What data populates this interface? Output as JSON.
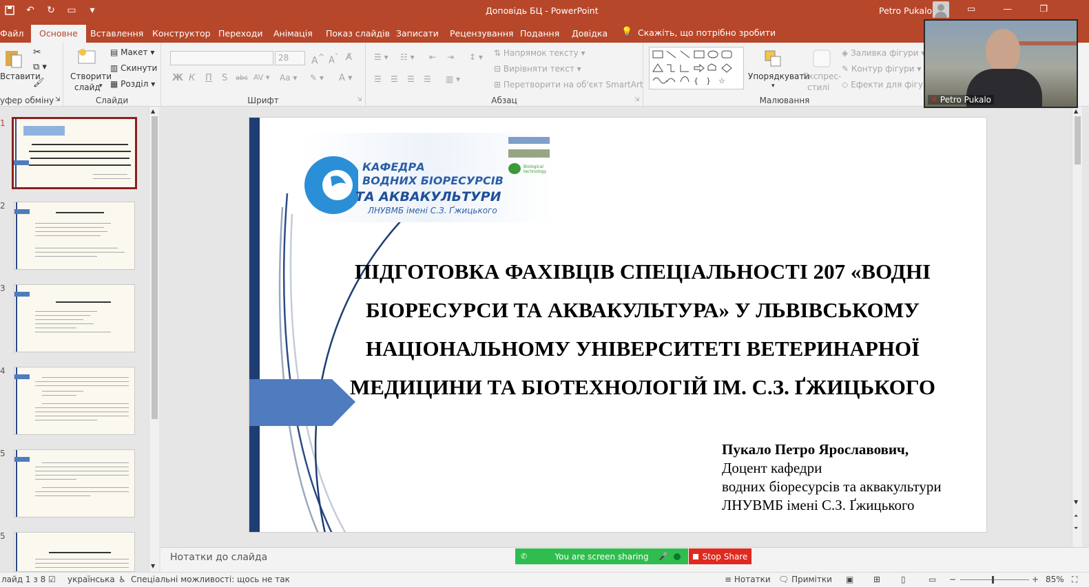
{
  "window": {
    "title": "Доповідь БЦ  -  PowerPoint",
    "user": "Petro Pukalo"
  },
  "tabs": [
    "Файл",
    "Основне",
    "Вставлення",
    "Конструктор",
    "Переходи",
    "Анімація",
    "Показ слайдів",
    "Записати",
    "Рецензування",
    "Подання",
    "Довідка"
  ],
  "tell_me": "Скажіть, що потрібно зробити",
  "ribbon": {
    "clipboard": {
      "paste": "Вставити",
      "label": "уфер обміну"
    },
    "slides": {
      "new_slide_1": "Створити",
      "new_slide_2": "слайд",
      "layout": "Макет",
      "reset": "Скинути",
      "section": "Розділ",
      "label": "Слайди"
    },
    "font": {
      "size": "28",
      "label": "Шрифт",
      "aa": "Aa"
    },
    "paragraph": {
      "text_direction": "Напрямок тексту",
      "align_text": "Вирівняти текст",
      "smartart": "Перетворити на об'єкт SmartArt",
      "label": "Абзац"
    },
    "drawing": {
      "arrange": "Упорядкувати",
      "quick_styles_1": "Експрес-",
      "quick_styles_2": "стилі",
      "shape_fill": "Заливка фігури",
      "shape_outline": "Контур фігури",
      "shape_effects": "Ефекти для фігур",
      "label": "Малювання"
    }
  },
  "thumbnails": [
    {
      "num": "1"
    },
    {
      "num": "2"
    },
    {
      "num": "3"
    },
    {
      "num": "4"
    },
    {
      "num": "5"
    },
    {
      "num": "5"
    }
  ],
  "slide": {
    "logo": {
      "line1": "КАФЕДРА",
      "line2": "ВОДНИХ БІОРЕСУРСІВ",
      "line3": "ТА АКВАКУЛЬТУРИ",
      "line4": "ЛНУВМБ імені С.З. Ґжицького",
      "small": "Biological technology"
    },
    "title": "ПІДГОТОВКА ФАХІВЦІВ СПЕЦІАЛЬНОСТІ 207 «ВОДНІ БІОРЕСУРСИ ТА АКВАКУЛЬТУРА» У ЛЬВІВСЬКОМУ НАЦІОНАЛЬНОМУ УНІВЕРСИТЕТІ ВЕТЕРИНАРНОЇ МЕДИЦИНИ ТА БІОТЕХНОЛОГІЙ ІМ. С.З. ҐЖИЦЬКОГО",
    "author_name": "Пукало Петро Ярославович,",
    "author_pos": "Доцент кафедри",
    "author_dept": "водних біоресурсів та аквакультури",
    "author_univ": "ЛНУВМБ імені С.З. Ґжицького"
  },
  "notes": "Нотатки до слайда",
  "share": {
    "text": "You are screen sharing",
    "stop": "Stop Share"
  },
  "status": {
    "slide": "лайд 1 з 8",
    "lang": "українська",
    "access": "Спеціальні можливості: щось не так",
    "notes": "Нотатки",
    "comments": "Примітки",
    "zoom": "85%"
  },
  "video": {
    "name": "Petro Pukalo"
  },
  "colors": {
    "accent": "#b7472a",
    "slide_blue": "#4f7bbf",
    "navy": "#1f3d73",
    "share_green": "#2ebd4e",
    "stop_red": "#e0291f"
  }
}
